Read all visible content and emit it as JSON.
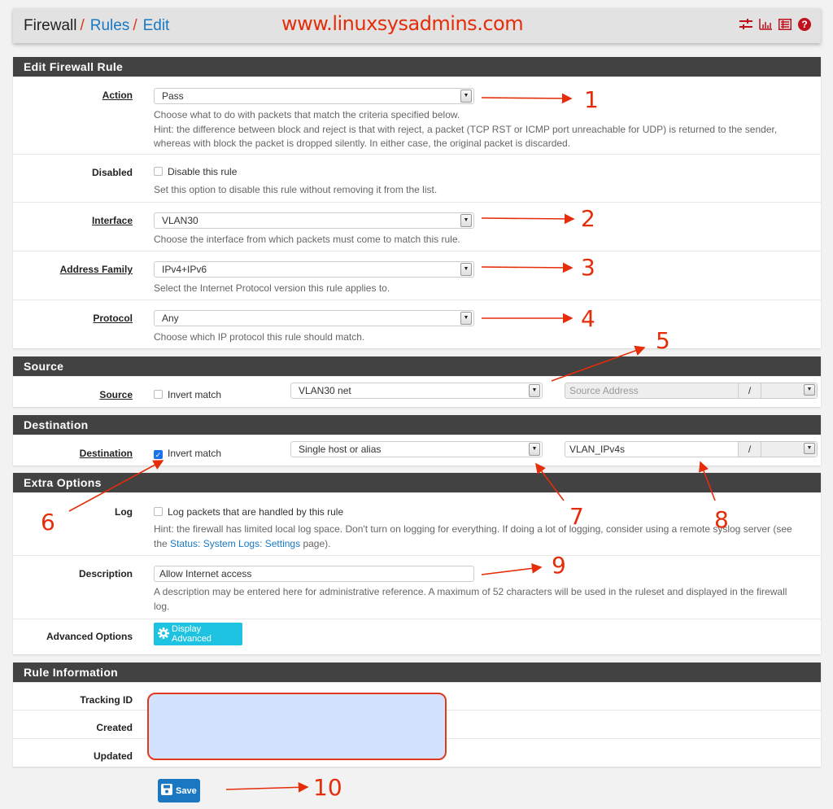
{
  "header": {
    "breadcrumb": {
      "root": "Firewall",
      "sep": "/",
      "rules": "Rules",
      "edit": "Edit"
    },
    "watermark": "www.linuxsysadmins.com",
    "icons": [
      "sliders-icon",
      "chart-icon",
      "list-icon",
      "help-icon"
    ],
    "help_glyph": "?"
  },
  "edit_rule": {
    "title": "Edit Firewall Rule",
    "action": {
      "label": "Action",
      "value": "Pass",
      "help1": "Choose what to do with packets that match the criteria specified below.",
      "help2": "Hint: the difference between block and reject is that with reject, a packet (TCP RST or ICMP port unreachable for UDP) is returned to the sender,",
      "help3": "whereas with block the packet is dropped silently. In either case, the original packet is discarded."
    },
    "disabled": {
      "label": "Disabled",
      "checkbox_label": "Disable this rule",
      "checked": false,
      "help": "Set this option to disable this rule without removing it from the list."
    },
    "interface": {
      "label": "Interface",
      "value": "VLAN30",
      "help": "Choose the interface from which packets must come to match this rule."
    },
    "address_family": {
      "label": "Address Family",
      "value": "IPv4+IPv6",
      "help": "Select the Internet Protocol version this rule applies to."
    },
    "protocol": {
      "label": "Protocol",
      "value": "Any",
      "help": "Choose which IP protocol this rule should match."
    }
  },
  "source": {
    "title": "Source",
    "label": "Source",
    "invert_label": "Invert match",
    "invert_checked": false,
    "type": "VLAN30 net",
    "address_placeholder": "Source Address",
    "slash": "/"
  },
  "destination": {
    "title": "Destination",
    "label": "Destination",
    "invert_label": "Invert match",
    "invert_checked": true,
    "type": "Single host or alias",
    "address": "VLAN_IPv4s",
    "slash": "/"
  },
  "extra": {
    "title": "Extra Options",
    "log": {
      "label": "Log",
      "checkbox_label": "Log packets that are handled by this rule",
      "checked": false,
      "help1": "Hint: the firewall has limited local log space. Don't turn on logging for everything. If doing a lot of logging, consider using a remote syslog server (see",
      "help2_pre": "the",
      "help2_link": "Status: System Logs: Settings",
      "help2_post": "page)."
    },
    "description": {
      "label": "Description",
      "value": "Allow Internet access",
      "help1": "A description may be entered here for administrative reference. A maximum of 52 characters will be used in the ruleset and displayed in the firewall",
      "help2": "log."
    },
    "advanced": {
      "label": "Advanced Options",
      "button": "Display Advanced"
    }
  },
  "rule_info": {
    "title": "Rule Information",
    "tracking_label": "Tracking ID",
    "created_label": "Created",
    "updated_label": "Updated"
  },
  "save_button": "Save",
  "annotations": [
    "1",
    "2",
    "3",
    "4",
    "5",
    "6",
    "7",
    "8",
    "9",
    "10"
  ],
  "colors": {
    "accent_link": "#1a78c2",
    "annotation_red": "#e52d0a",
    "panel_header": "#424242",
    "advanced_button": "#1dc3e0",
    "redaction_fill": "#d3e2fd"
  }
}
